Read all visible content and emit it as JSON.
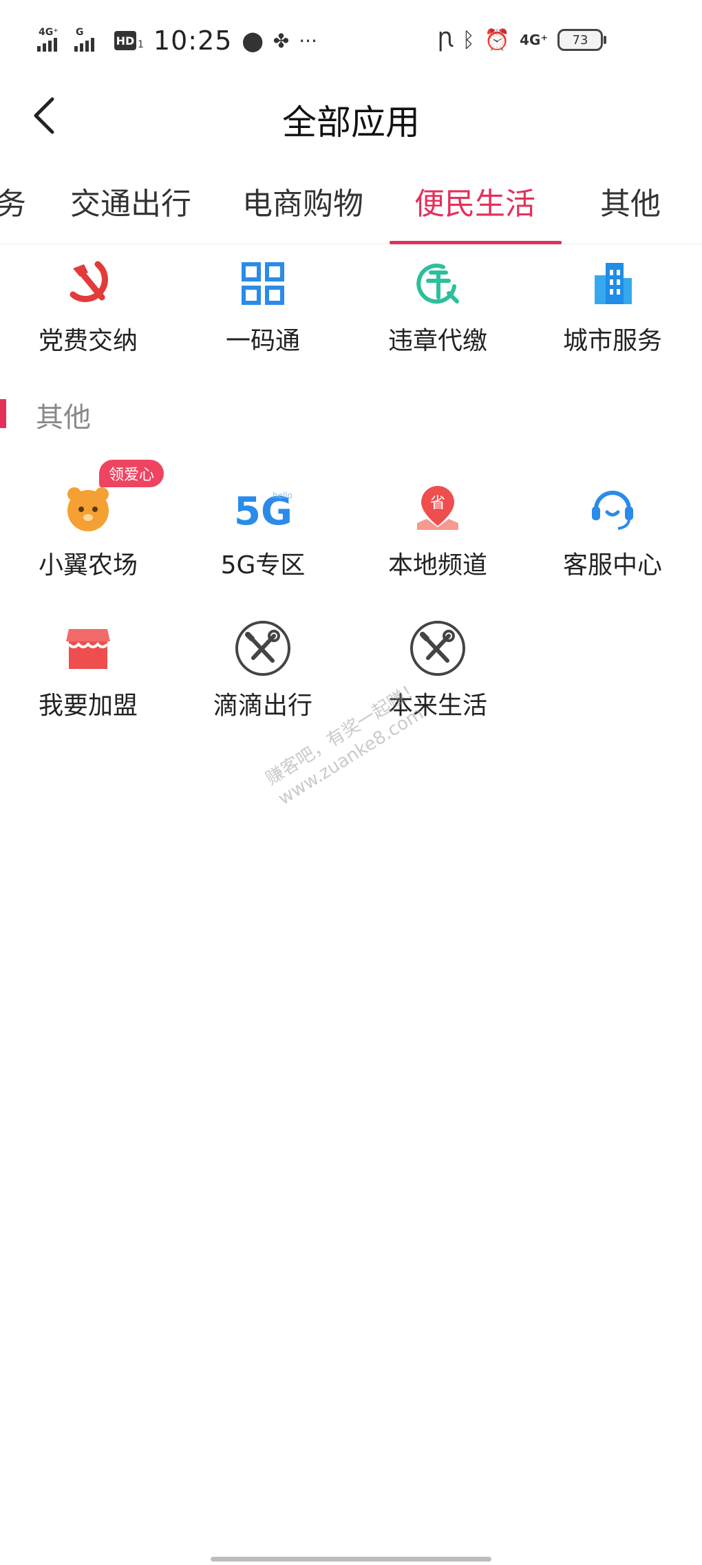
{
  "status_bar": {
    "net1": "4G⁺",
    "net2": "G",
    "hd": "HD",
    "hd_sub": "1",
    "time": "10:25",
    "more": "···",
    "net_right": "4G⁺",
    "battery": "73"
  },
  "header": {
    "title": "全部应用"
  },
  "tabs": [
    {
      "label": "务"
    },
    {
      "label": "交通出行"
    },
    {
      "label": "电商购物"
    },
    {
      "label": "便民生活"
    },
    {
      "label": "其他"
    }
  ],
  "active_tab_index": 3,
  "top_row": [
    {
      "label": "党费交纳",
      "icon": "hammer-sickle-icon"
    },
    {
      "label": "一码通",
      "icon": "qr-grid-icon"
    },
    {
      "label": "违章代缴",
      "icon": "violation-icon"
    },
    {
      "label": "城市服务",
      "icon": "building-icon"
    }
  ],
  "section": {
    "title": "其他"
  },
  "other_items": [
    {
      "label": "小翼农场",
      "icon": "bear-icon",
      "badge": "领爱心"
    },
    {
      "label": "5G专区",
      "icon": "5g-icon"
    },
    {
      "label": "本地频道",
      "icon": "location-province-icon",
      "icon_text": "省"
    },
    {
      "label": "客服中心",
      "icon": "headset-icon"
    },
    {
      "label": "我要加盟",
      "icon": "shop-icon"
    },
    {
      "label": "滴滴出行",
      "icon": "tools-icon"
    },
    {
      "label": "本来生活",
      "icon": "tools-icon"
    }
  ],
  "watermark": {
    "line1": "赚客吧，有奖一起赚！",
    "line2": "www.zuanke8.com"
  },
  "colors": {
    "accent": "#e3305a",
    "blue": "#2a8be8",
    "red": "#ee4e4e",
    "orange": "#f39b2f"
  }
}
